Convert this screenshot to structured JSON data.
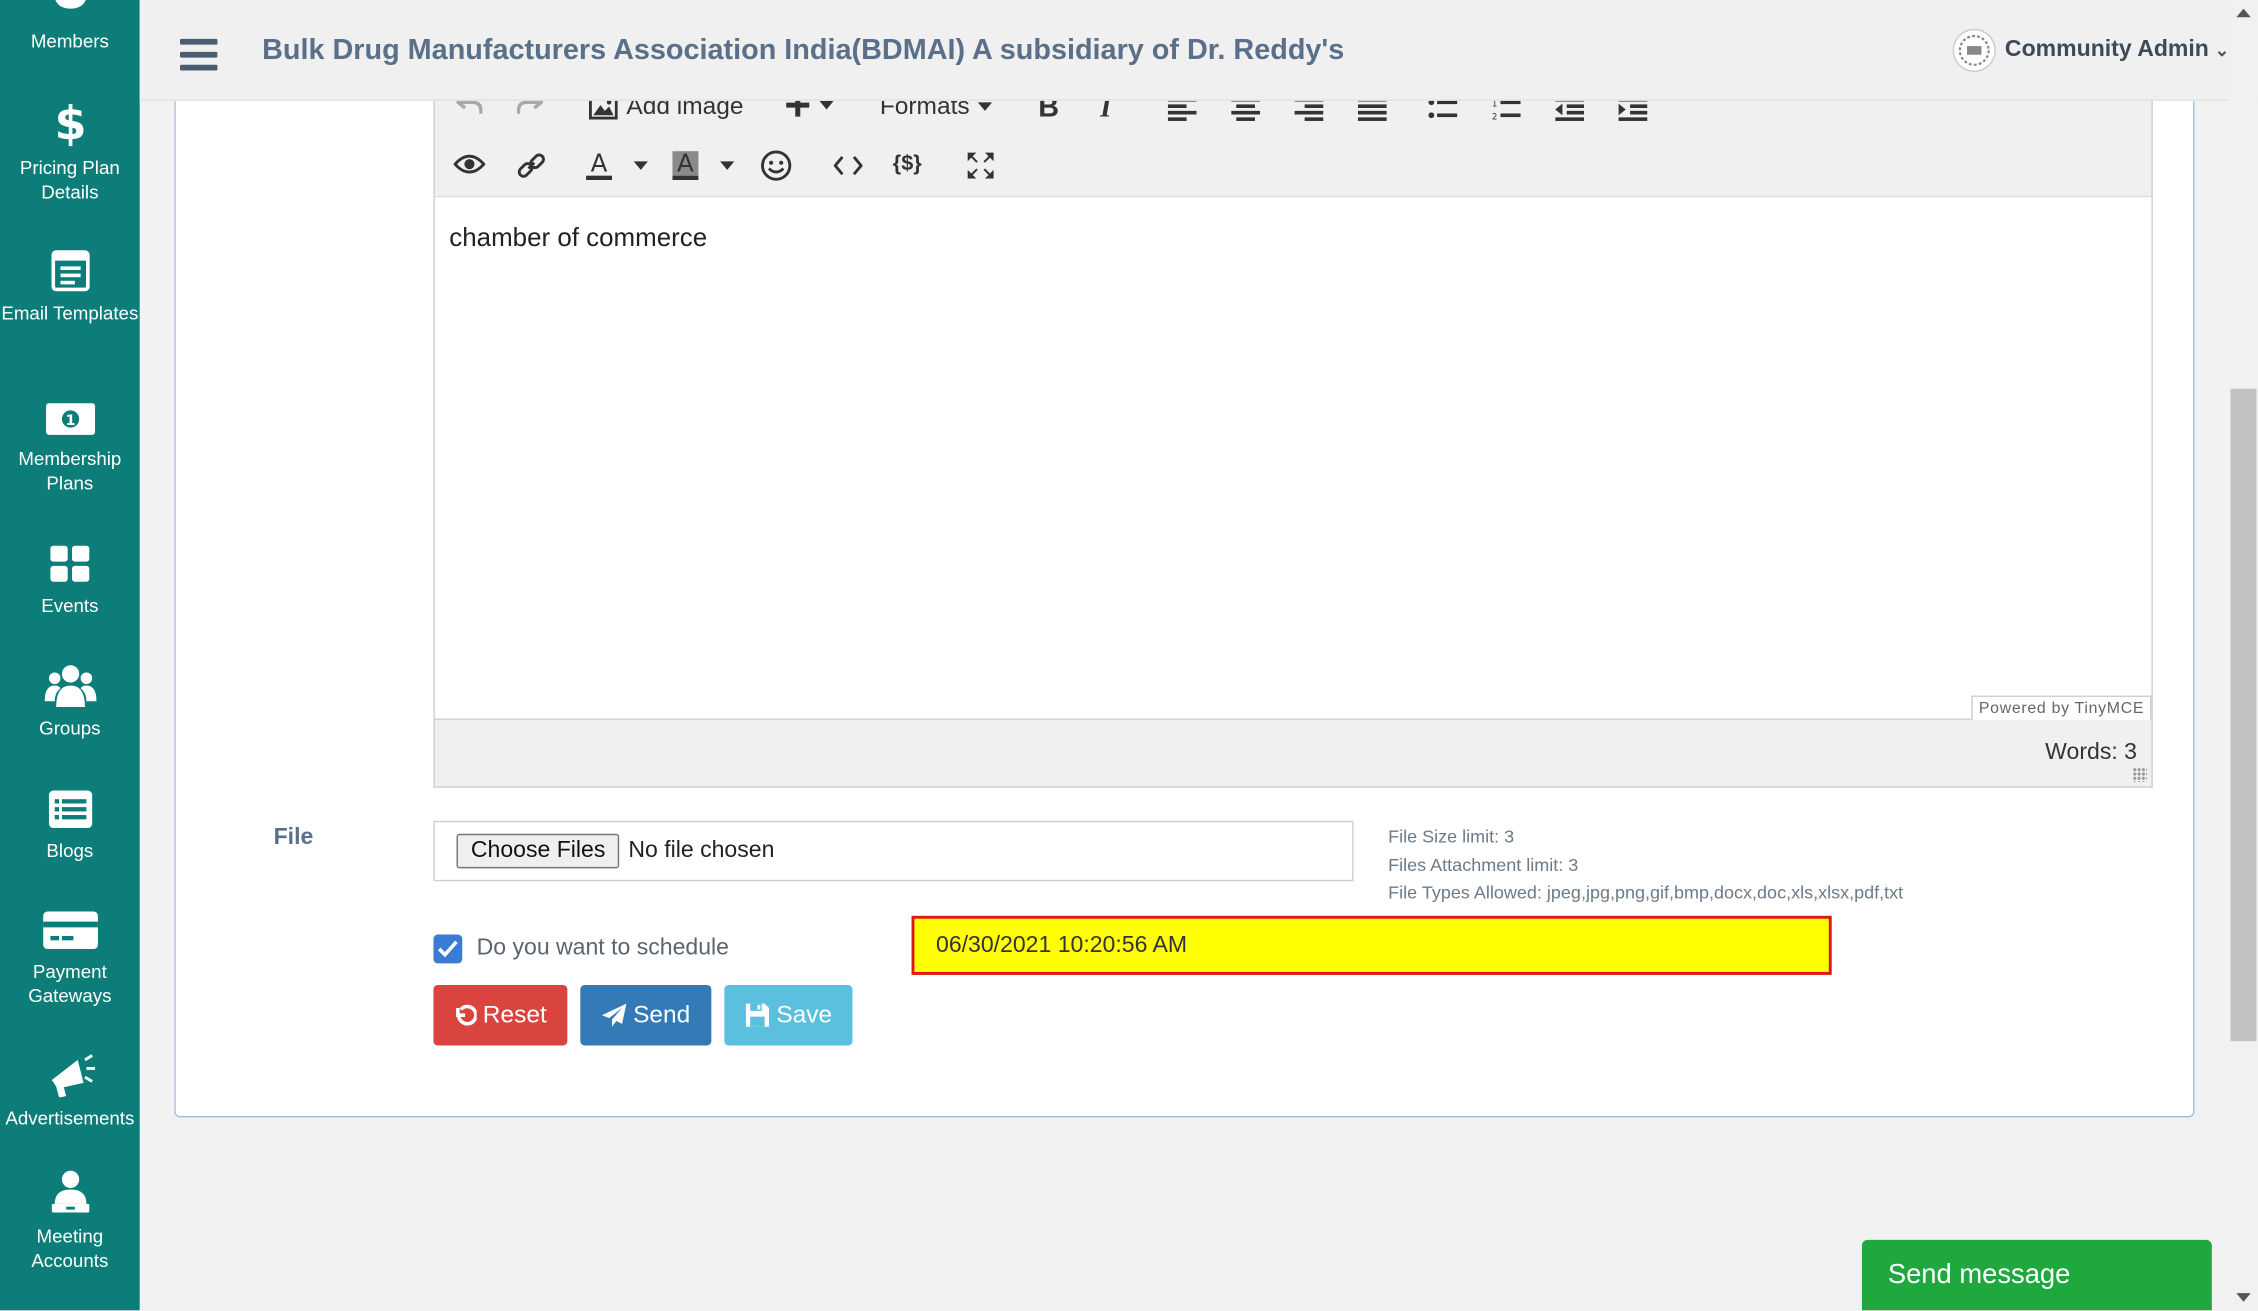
{
  "sidebar": {
    "items": [
      {
        "label": "Members",
        "icon": "member-icon"
      },
      {
        "label": "Pricing Plan Details",
        "icon": "dollar-icon"
      },
      {
        "label": "Email Templates",
        "icon": "email-template-icon"
      },
      {
        "label": "Membership Plans",
        "icon": "money-icon"
      },
      {
        "label": "Events",
        "icon": "grid-icon"
      },
      {
        "label": "Groups",
        "icon": "users-icon"
      },
      {
        "label": "Blogs",
        "icon": "list-icon"
      },
      {
        "label": "Payment Gateways",
        "icon": "credit-card-icon"
      },
      {
        "label": "Advertisements",
        "icon": "bullhorn-icon"
      },
      {
        "label": "Meeting Accounts",
        "icon": "user-laptop-icon"
      }
    ]
  },
  "header": {
    "org_title": "Bulk Drug Manufacturers Association India(BDMAI) A subsidiary of Dr. Reddy's",
    "user_name": "Community Admin"
  },
  "editor": {
    "toolbar": {
      "add_image": "Add image",
      "formats": "Formats"
    },
    "content": "chamber of commerce",
    "powered_by": "Powered by TinyMCE",
    "word_count": "Words: 3"
  },
  "file": {
    "label": "File",
    "choose_button": "Choose Files",
    "status": "No file chosen",
    "info": {
      "size_limit": "File Size limit: 3",
      "attachment_limit": "Files Attachment limit: 3",
      "types_allowed": "File Types Allowed: jpeg,jpg,png,gif,bmp,docx,doc,xls,xlsx,pdf,txt"
    }
  },
  "schedule": {
    "label": "Do you want to schedule",
    "checked": true,
    "datetime": "06/30/2021 10:20:56 AM"
  },
  "buttons": {
    "reset": "Reset",
    "send": "Send",
    "save": "Save"
  },
  "send_message": "Send message",
  "colors": {
    "sidebar": "#0d7d7a",
    "reset": "#d9443e",
    "send": "#337ab7",
    "save": "#5bc0de",
    "highlight": "#ffff00",
    "highlight_border": "#e0141e",
    "send_message": "#1ea83e"
  }
}
